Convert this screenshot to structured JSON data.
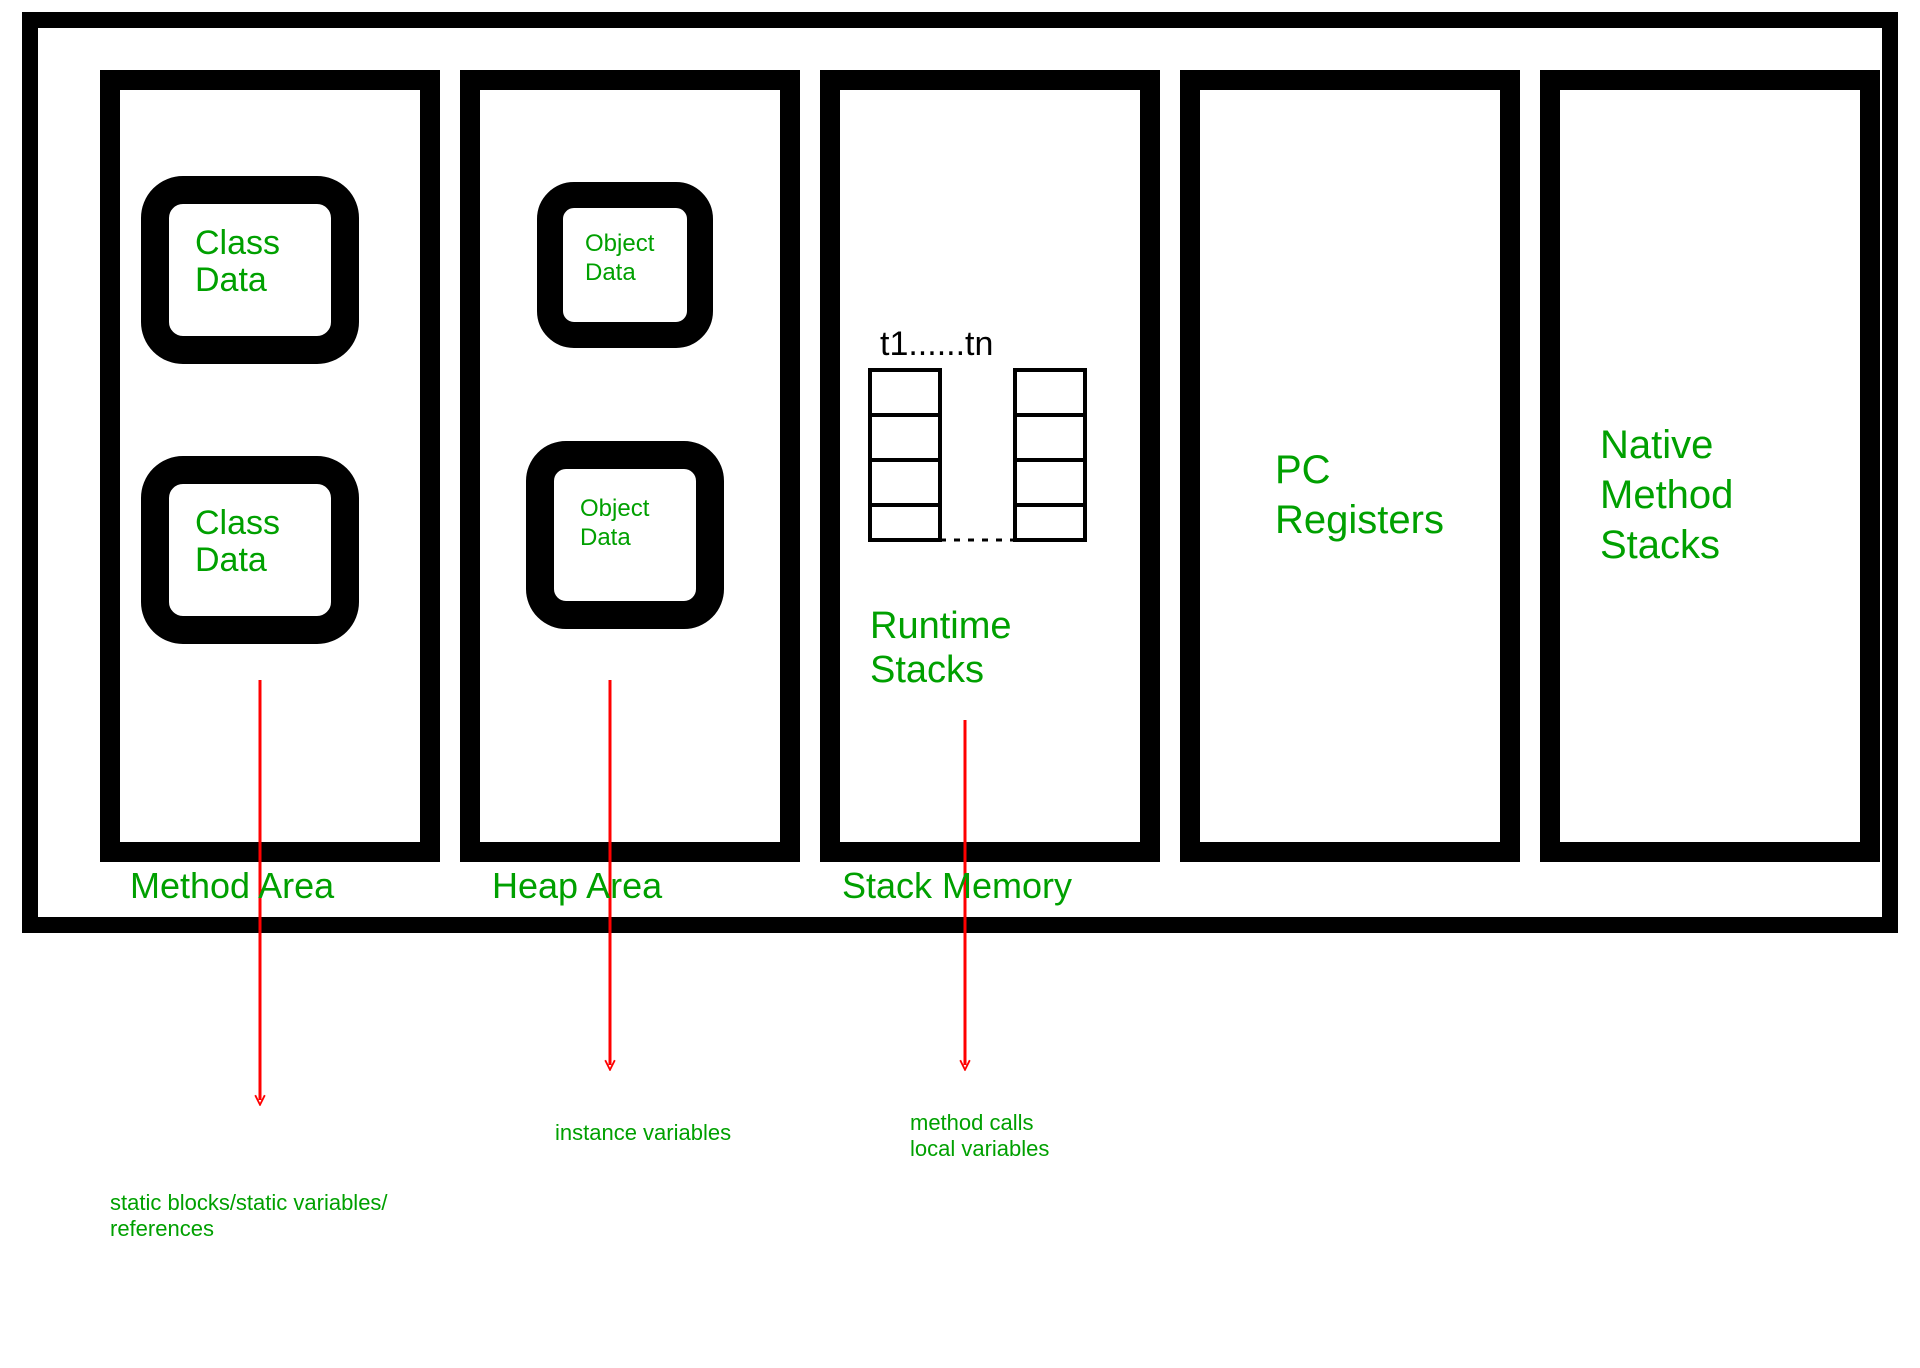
{
  "columns": {
    "method_area": {
      "label": "Method Area",
      "cells": [
        "Class\nData",
        "Class\nData"
      ],
      "annotation": "static blocks/static variables/\nreferences"
    },
    "heap_area": {
      "label": "Heap Area",
      "cells": [
        "Object\nData",
        "Object\nData"
      ],
      "annotation": "instance variables"
    },
    "stack_memory": {
      "label": "Stack Memory",
      "threads_label": "t1......tn",
      "runtime_label": "Runtime\nStacks",
      "annotation": "method calls\nlocal variables"
    },
    "pc_registers": {
      "label": "PC\nRegisters"
    },
    "native_method_stacks": {
      "label": "Native\nMethod\nStacks"
    }
  },
  "colors": {
    "stroke": "#000000",
    "text_green": "#00a000",
    "arrow_red": "#ff0000"
  }
}
